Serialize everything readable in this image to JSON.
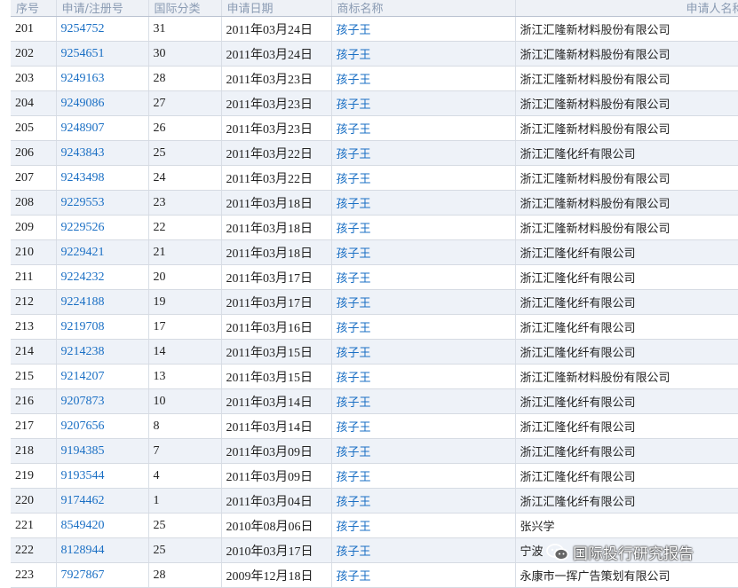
{
  "headers": [
    "序号",
    "申请/注册号",
    "国际分类",
    "申请日期",
    "商标名称",
    "申请人名称"
  ],
  "rows": [
    [
      "201",
      "9254752",
      "31",
      "2011年03月24日",
      "孩子王",
      "浙江汇隆新材料股份有限公司"
    ],
    [
      "202",
      "9254651",
      "30",
      "2011年03月24日",
      "孩子王",
      "浙江汇隆新材料股份有限公司"
    ],
    [
      "203",
      "9249163",
      "28",
      "2011年03月23日",
      "孩子王",
      "浙江汇隆新材料股份有限公司"
    ],
    [
      "204",
      "9249086",
      "27",
      "2011年03月23日",
      "孩子王",
      "浙江汇隆新材料股份有限公司"
    ],
    [
      "205",
      "9248907",
      "26",
      "2011年03月23日",
      "孩子王",
      "浙江汇隆新材料股份有限公司"
    ],
    [
      "206",
      "9243843",
      "25",
      "2011年03月22日",
      "孩子王",
      "浙江汇隆化纤有限公司"
    ],
    [
      "207",
      "9243498",
      "24",
      "2011年03月22日",
      "孩子王",
      "浙江汇隆新材料股份有限公司"
    ],
    [
      "208",
      "9229553",
      "23",
      "2011年03月18日",
      "孩子王",
      "浙江汇隆新材料股份有限公司"
    ],
    [
      "209",
      "9229526",
      "22",
      "2011年03月18日",
      "孩子王",
      "浙江汇隆新材料股份有限公司"
    ],
    [
      "210",
      "9229421",
      "21",
      "2011年03月18日",
      "孩子王",
      "浙江汇隆化纤有限公司"
    ],
    [
      "211",
      "9224232",
      "20",
      "2011年03月17日",
      "孩子王",
      "浙江汇隆化纤有限公司"
    ],
    [
      "212",
      "9224188",
      "19",
      "2011年03月17日",
      "孩子王",
      "浙江汇隆化纤有限公司"
    ],
    [
      "213",
      "9219708",
      "17",
      "2011年03月16日",
      "孩子王",
      "浙江汇隆化纤有限公司"
    ],
    [
      "214",
      "9214238",
      "14",
      "2011年03月15日",
      "孩子王",
      "浙江汇隆化纤有限公司"
    ],
    [
      "215",
      "9214207",
      "13",
      "2011年03月15日",
      "孩子王",
      "浙江汇隆新材料股份有限公司"
    ],
    [
      "216",
      "9207873",
      "10",
      "2011年03月14日",
      "孩子王",
      "浙江汇隆化纤有限公司"
    ],
    [
      "217",
      "9207656",
      "8",
      "2011年03月14日",
      "孩子王",
      "浙江汇隆化纤有限公司"
    ],
    [
      "218",
      "9194385",
      "7",
      "2011年03月09日",
      "孩子王",
      "浙江汇隆化纤有限公司"
    ],
    [
      "219",
      "9193544",
      "4",
      "2011年03月09日",
      "孩子王",
      "浙江汇隆化纤有限公司"
    ],
    [
      "220",
      "9174462",
      "1",
      "2011年03月04日",
      "孩子王",
      "浙江汇隆化纤有限公司"
    ],
    [
      "221",
      "8549420",
      "25",
      "2010年08月06日",
      "孩子王",
      "张兴学"
    ],
    [
      "222",
      "8128944",
      "25",
      "2010年03月17日",
      "孩子王",
      "宁波"
    ],
    [
      "223",
      "7927867",
      "28",
      "2009年12月18日",
      "孩子王",
      "永康市一挥广告策划有限公司"
    ]
  ],
  "watermark": {
    "text": "国际投行研究报告",
    "icon": "wechat-icon"
  },
  "colors": {
    "link": "#1a6fc4",
    "header_bg": "#eef1f6",
    "row_alt": "#eef2f8",
    "header_text": "#8a9bb3"
  }
}
